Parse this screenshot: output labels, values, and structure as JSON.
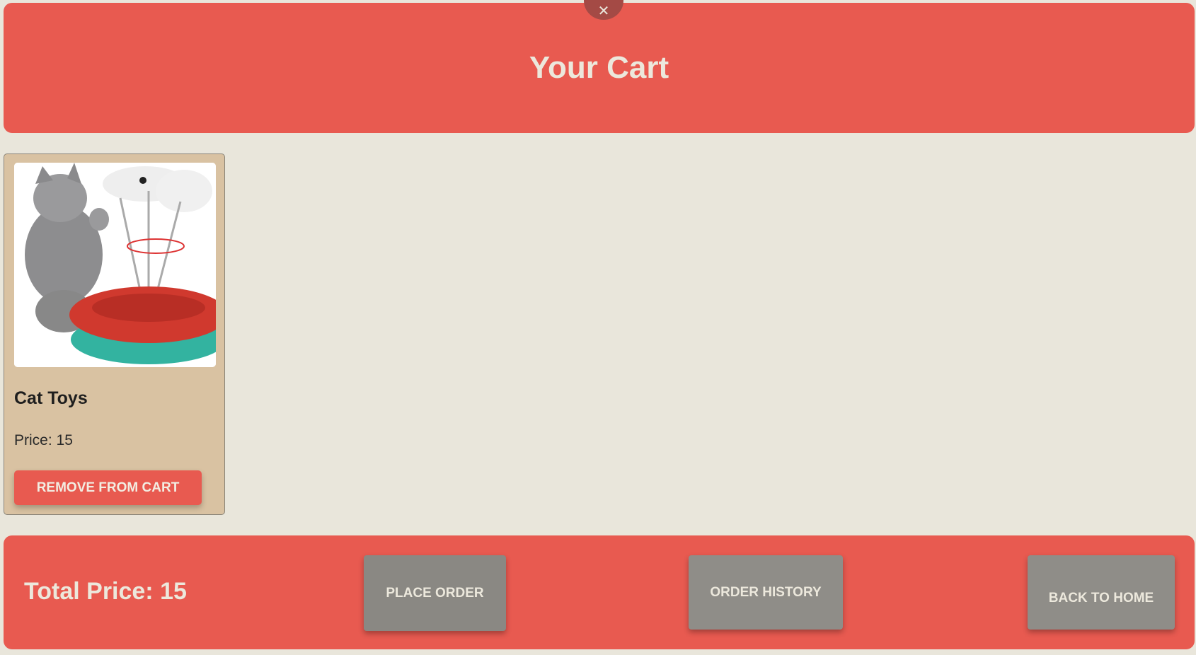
{
  "header": {
    "title": "Your Cart",
    "close_icon": "close-icon"
  },
  "cart": {
    "items": [
      {
        "name": "Cat Toys",
        "price_label": "Price: 15",
        "remove_label": "REMOVE FROM CART",
        "image": "cat-toy-product-image"
      }
    ]
  },
  "footer": {
    "total_label": "Total Price: 15",
    "place_order_label": "PLACE ORDER",
    "order_history_label": "ORDER HISTORY",
    "back_home_label": "BACK TO HOME"
  },
  "colors": {
    "accent": "#e85a50",
    "background": "#e9e6db",
    "card": "#d9c2a2",
    "button_gray": "#8a8883"
  }
}
